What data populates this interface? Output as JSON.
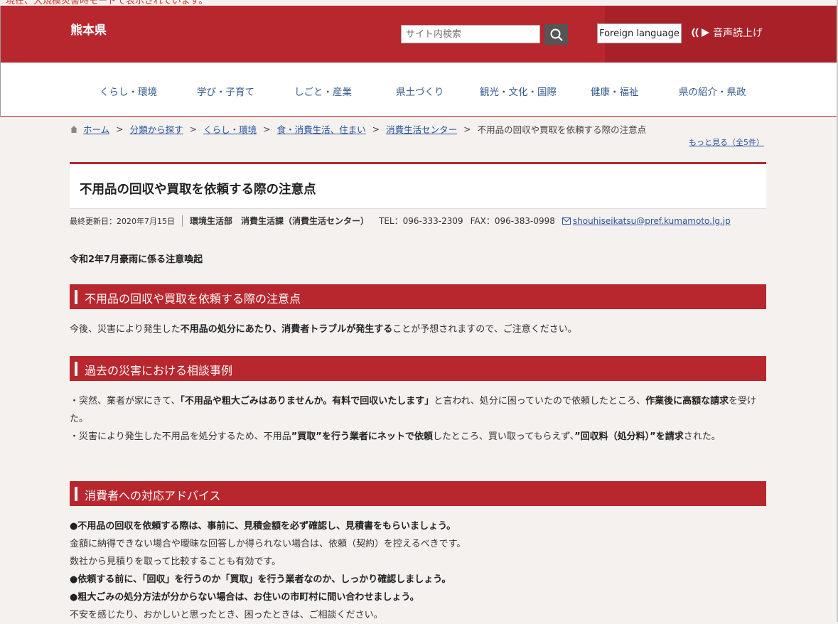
{
  "notice": "現在、大規模災害時モードで表示されています。",
  "header": {
    "logo": "熊本県",
    "search_placeholder": "サイト内検索",
    "foreign_language": "Foreign language",
    "read_aloud": "音声読上げ"
  },
  "nav": [
    "くらし・環境",
    "学び・子育て",
    "しごと・産業",
    "県土づくり",
    "観光・文化・国際",
    "健康・福祉",
    "県の紹介・県政"
  ],
  "breadcrumb": {
    "items": [
      "ホーム",
      "分類から探す",
      "くらし・環境",
      "食・消費生活、住まい",
      "消費生活センター"
    ],
    "current": "不用品の回収や買取を依頼する際の注意点",
    "sep": ">",
    "more": "もっと見る（全5件）"
  },
  "page_title": "不用品の回収や買取を依頼する際の注意点",
  "meta": {
    "updated": "最終更新日：2020年7月15日",
    "department": "環境生活部　消費生活課（消費生活センター）",
    "tel": "TEL：096-333-2309",
    "fax": "FAX：096-383-0998",
    "email": "shouhiseikatsu@pref.kumamoto.lg.jp"
  },
  "subheading": "令和2年7月豪雨に係る注意喚起",
  "sections": {
    "s1": {
      "title": "不用品の回収や買取を依頼する際の注意点",
      "p1a": "今後、災害により発生した",
      "p1b": "不用品の処分にあたり、消費者トラブルが発生する",
      "p1c": "ことが予想されますので、ご注意ください。"
    },
    "s2": {
      "title": "過去の災害における相談事例",
      "c1a": "・突然、業者が家にきて、",
      "c1b": "「不用品や粗大ごみはありませんか。有料で回収いたします」",
      "c1c": "と言われ、処分に困っていたので依頼したところ、",
      "c1d": "作業後に高額な請求",
      "c1e": "を受けた。",
      "c2a": "・災害により発生した不用品を処分するため、不用品",
      "c2b": "”買取”を行う業者にネットで依頼",
      "c2c": "したところ、買い取ってもらえず、",
      "c2d": "”回収料（処分料）”を請求",
      "c2e": "された。"
    },
    "s3": {
      "title": "消費者への対応アドバイス",
      "a1": "●不用品の回収を依頼する際は、事前に、見積金額を必ず確認し、見積書をもらいましょう。",
      "a2": "金額に納得できない場合や曖昧な回答しか得られない場合は、依頼（契約）を控えるべきです。",
      "a3": "数社から見積りを取って比較することも有効です。",
      "a4": "●依頼する前に、「回収」を行うのか「買取」を行う業者なのか、しっかり確認しましょう。",
      "a5": "●粗大ごみの処分方法が分からない場合は、お住いの市町村に問い合わせましょう。",
      "a6": "不安を感じたり、おかしいと思ったとき、困ったときは、ご相談ください。"
    }
  },
  "colors": {
    "header_red": "#b8262e",
    "link_blue": "#2a55a0",
    "nav_blue": "#355a8a"
  }
}
